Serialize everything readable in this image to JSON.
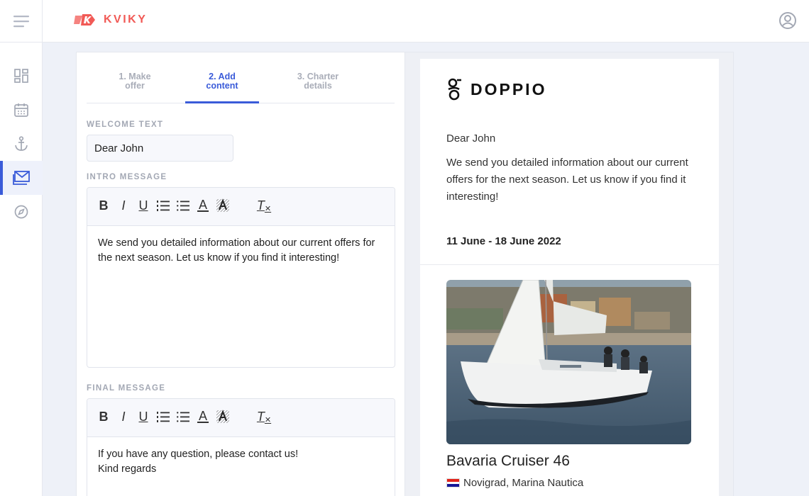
{
  "app": {
    "logo_text": "KVIKY"
  },
  "nav": {
    "items": [
      {
        "name": "dashboard",
        "icon": "dashboard-icon",
        "active": false
      },
      {
        "name": "calendar",
        "icon": "calendar-icon",
        "active": false
      },
      {
        "name": "charters",
        "icon": "anchor-icon",
        "active": false
      },
      {
        "name": "offers",
        "icon": "mail-icon",
        "active": true
      },
      {
        "name": "explore",
        "icon": "compass-icon",
        "active": false
      }
    ]
  },
  "steps": [
    {
      "label_line1": "1. Make",
      "label_line2": "offer",
      "active": false
    },
    {
      "label_line1": "2. Add",
      "label_line2": "content",
      "active": true
    },
    {
      "label_line1": "3. Charter",
      "label_line2": "details",
      "active": false
    }
  ],
  "form": {
    "welcome_label": "WELCOME TEXT",
    "welcome_value": "Dear John",
    "intro_label": "INTRO MESSAGE",
    "intro_text": "We send you detailed information about our current offers for the next season. Let us know if you find it interesting!",
    "final_label": "FINAL MESSAGE",
    "final_line1": "If you have any question, please contact us!",
    "final_line2": "Kind regards"
  },
  "toolbar": {
    "bold": "B",
    "italic": "I",
    "underline": "U",
    "font_color": "A",
    "clear_format": "T"
  },
  "preview": {
    "brand_name": "DOPPIO",
    "greeting": "Dear John",
    "intro": "We send you detailed information about our current offers for the next season. Let us know if you find it interesting!",
    "dates": "11 June - 18 June 2022",
    "boat_name": "Bavaria Cruiser 46",
    "location": "Novigrad, Marina Nautica"
  },
  "colors": {
    "accent": "#3a5bd9",
    "brand": "#f15a56",
    "flag_red": "#e2231a",
    "flag_white": "#ffffff",
    "flag_blue": "#171796"
  }
}
